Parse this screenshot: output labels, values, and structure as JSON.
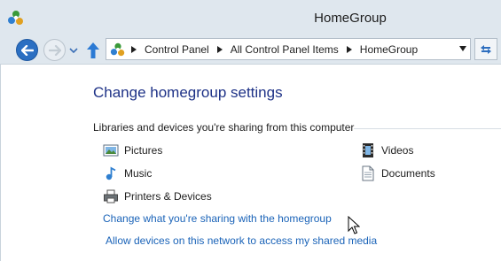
{
  "window": {
    "title": "HomeGroup",
    "icon": "homegroup-icon"
  },
  "nav": {
    "back_icon": "back-arrow-icon",
    "forward_icon": "forward-arrow-icon",
    "recent_icon": "chevron-down-icon",
    "up_icon": "up-arrow-icon",
    "refresh_icon": "refresh-icon"
  },
  "address": {
    "icon": "homegroup-icon",
    "crumbs": [
      "Control Panel",
      "All Control Panel Items",
      "HomeGroup"
    ]
  },
  "main": {
    "title": "Change homegroup settings",
    "sharing_header": "Libraries and devices you're sharing from this computer",
    "libraries": [
      {
        "label": "Pictures",
        "icon": "pictures-icon"
      },
      {
        "label": "Music",
        "icon": "music-icon"
      },
      {
        "label": "Printers & Devices",
        "icon": "printer-icon"
      },
      {
        "label": "Videos",
        "icon": "videos-icon"
      },
      {
        "label": "Documents",
        "icon": "documents-icon"
      }
    ],
    "links": [
      "Change what you're sharing with the homegroup",
      "Allow devices on this network to access my shared media"
    ]
  },
  "colors": {
    "chrome": "#dfe7ee",
    "title_blue": "#1e3287",
    "link_blue": "#1a63b8",
    "back_button": "#2b6fc2"
  }
}
